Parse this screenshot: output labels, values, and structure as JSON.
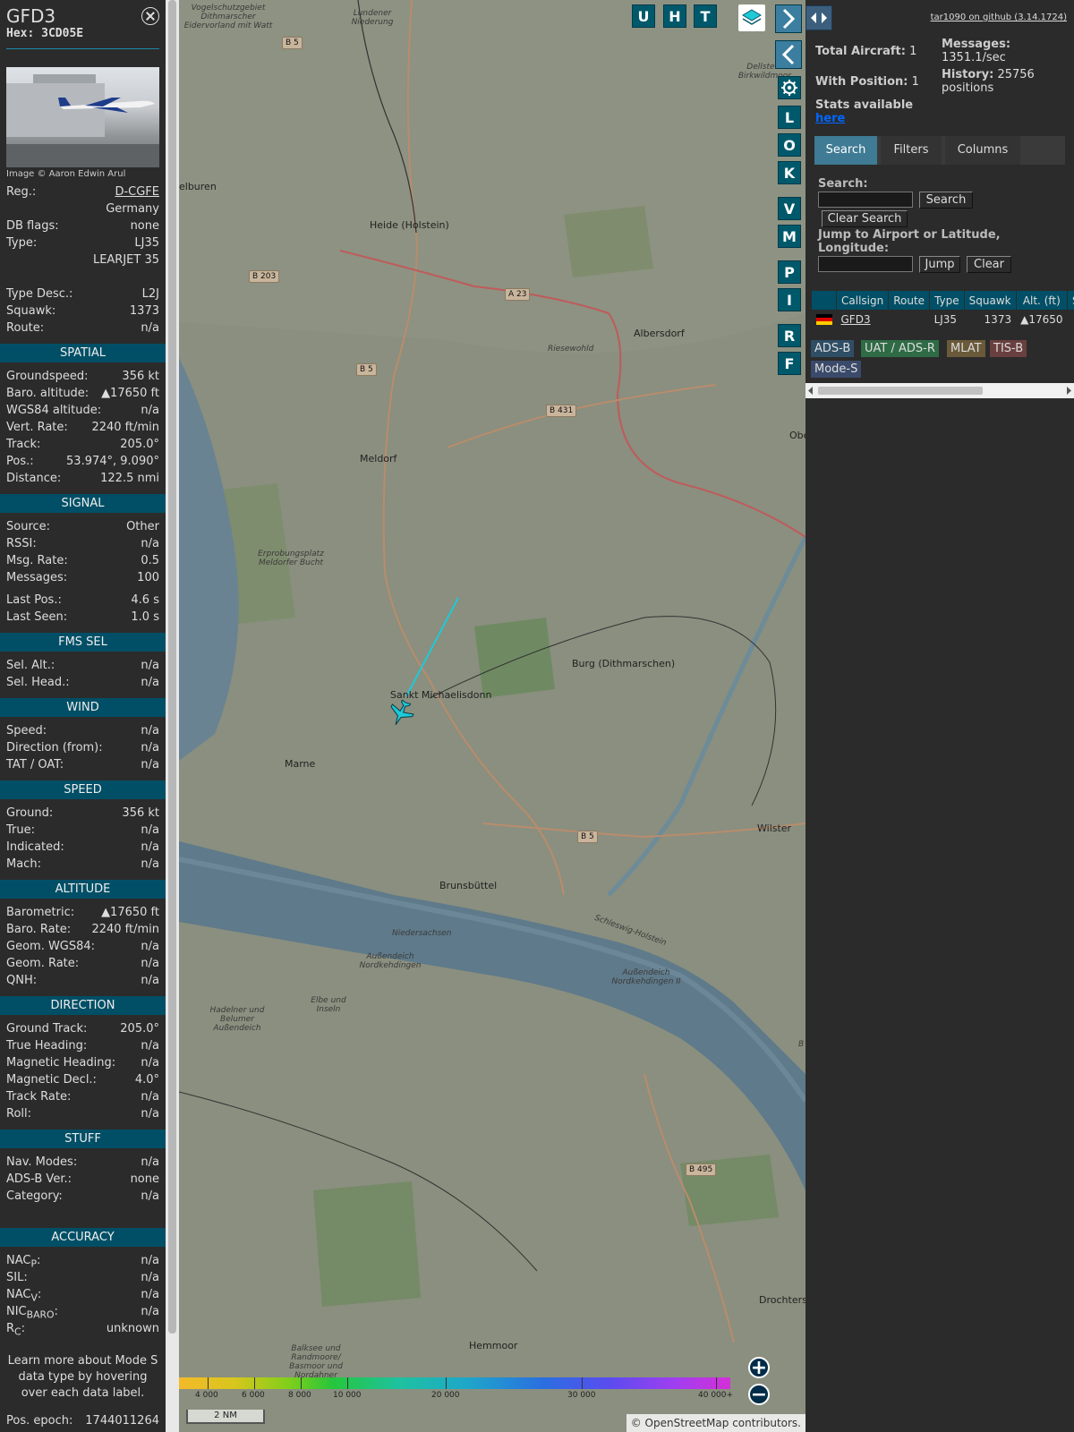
{
  "sidebar": {
    "callsign": "GFD3",
    "hex": "Hex: 3CD05E",
    "photo_credit": "Image © Aaron Edwin Arul",
    "info": [
      {
        "label": "Reg.:",
        "value": "D-CGFE",
        "link": true
      },
      {
        "label": "",
        "value": "Germany"
      },
      {
        "label": "DB flags:",
        "value": "none"
      },
      {
        "label": "Type:",
        "value": "LJ35"
      },
      {
        "label": "",
        "value": "LEARJET 35"
      },
      {
        "label": "",
        "value": ""
      },
      {
        "label": "Type Desc.:",
        "value": "L2J"
      },
      {
        "label": "Squawk:",
        "value": "1373"
      },
      {
        "label": "Route:",
        "value": "n/a"
      }
    ],
    "sections": [
      {
        "title": "SPATIAL",
        "rows": [
          {
            "label": "Groundspeed:",
            "value": "356 kt"
          },
          {
            "label": "Baro. altitude:",
            "value": "▲17650 ft"
          },
          {
            "label": "WGS84 altitude:",
            "value": "n/a"
          },
          {
            "label": "Vert. Rate:",
            "value": "2240 ft/min"
          },
          {
            "label": "Track:",
            "value": "205.0°"
          },
          {
            "label": "Pos.:",
            "value": "53.974°, 9.090°"
          },
          {
            "label": "Distance:",
            "value": "122.5 nmi"
          }
        ]
      },
      {
        "title": "SIGNAL",
        "rows": [
          {
            "label": "Source:",
            "value": "Other"
          },
          {
            "label": "RSSI:",
            "value": "n/a"
          },
          {
            "label": "Msg. Rate:",
            "value": "0.5"
          },
          {
            "label": "Messages:",
            "value": "100"
          },
          {
            "gap": true
          },
          {
            "label": "Last Pos.:",
            "value": "4.6 s"
          },
          {
            "label": "Last Seen:",
            "value": "1.0 s"
          }
        ]
      },
      {
        "title": "FMS SEL",
        "rows": [
          {
            "label": "Sel. Alt.:",
            "value": "n/a"
          },
          {
            "label": "Sel. Head.:",
            "value": "n/a"
          }
        ]
      },
      {
        "title": "WIND",
        "rows": [
          {
            "label": "Speed:",
            "value": "n/a"
          },
          {
            "label": "Direction (from):",
            "value": "n/a"
          },
          {
            "label": "TAT / OAT:",
            "value": "n/a"
          }
        ]
      },
      {
        "title": "SPEED",
        "rows": [
          {
            "label": "Ground:",
            "value": "356 kt"
          },
          {
            "label": "True:",
            "value": "n/a"
          },
          {
            "label": "Indicated:",
            "value": "n/a"
          },
          {
            "label": "Mach:",
            "value": "n/a"
          }
        ]
      },
      {
        "title": "ALTITUDE",
        "rows": [
          {
            "label": "Barometric:",
            "value": "▲17650 ft"
          },
          {
            "label": "Baro. Rate:",
            "value": "2240 ft/min"
          },
          {
            "label": "Geom. WGS84:",
            "value": "n/a"
          },
          {
            "label": "Geom. Rate:",
            "value": "n/a"
          },
          {
            "label": "QNH:",
            "value": "n/a"
          }
        ]
      },
      {
        "title": "DIRECTION",
        "rows": [
          {
            "label": "Ground Track:",
            "value": "205.0°"
          },
          {
            "label": "True Heading:",
            "value": "n/a"
          },
          {
            "label": "Magnetic Heading:",
            "value": "n/a"
          },
          {
            "label": "Magnetic Decl.:",
            "value": "4.0°"
          },
          {
            "label": "Track Rate:",
            "value": "n/a"
          },
          {
            "label": "Roll:",
            "value": "n/a"
          }
        ]
      },
      {
        "title": "STUFF",
        "rows": [
          {
            "label": "Nav. Modes:",
            "value": "n/a"
          },
          {
            "label": "ADS-B Ver.:",
            "value": "none"
          },
          {
            "label": "Category:",
            "value": "n/a"
          },
          {
            "gap": true
          },
          {
            "gap": true
          },
          {
            "gap": true
          }
        ]
      },
      {
        "title": "ACCURACY",
        "rows": [
          {
            "label": "NACP:",
            "value": "n/a",
            "html_label": "NAC<sub>P</sub>:"
          },
          {
            "label": "SIL:",
            "value": "n/a"
          },
          {
            "label": "NACV:",
            "value": "n/a",
            "html_label": "NAC<sub>V</sub>:"
          },
          {
            "label": "NICBARO:",
            "value": "n/a",
            "html_label": "NIC<sub>BARO</sub>:"
          },
          {
            "label": "RC:",
            "value": "unknown",
            "html_label": "R<sub>C</sub>:"
          }
        ]
      }
    ],
    "learn_more": "Learn more about Mode S data type by hovering over each data label.",
    "pos_epoch_label": "Pos. epoch:",
    "pos_epoch_value": "1744011264"
  },
  "map": {
    "top_buttons": [
      "U",
      "H",
      "T"
    ],
    "side_buttons": [
      "L",
      "O",
      "K",
      "V",
      "M",
      "P",
      "I",
      "R",
      "F"
    ],
    "places": [
      {
        "name": "Heide (Holstein)"
      },
      {
        "name": "Albersdorf"
      },
      {
        "name": "Meldorf"
      },
      {
        "name": "Burg (Dithmarschen)"
      },
      {
        "name": "Sankt Michaelisdonn"
      },
      {
        "name": "Marne"
      },
      {
        "name": "Wilster"
      },
      {
        "name": "Brunsbüttel"
      },
      {
        "name": "Hemmoor"
      },
      {
        "name": "Drochters"
      },
      {
        "name": "elburen"
      },
      {
        "name": "Obe"
      }
    ],
    "small_places": [
      "Riesewohld",
      "Erprobungsplatz Meldorfer Bucht",
      "Niedersachsen",
      "Schleswig-Holstein",
      "Außendeich Nordkehdingen",
      "Außendeich Nordkehdingen II",
      "Elbe und Inseln",
      "Hadelner und Belumer Außendeich",
      "Balksee und Randmoore/ Basmoor und Nordahner",
      "Dellstedter Birkwildmoor",
      "Lundener Niederung",
      "Vogelschutzgebiet Dithmarscher Eidervorland mit Watt",
      "B"
    ],
    "roads": [
      "B 5",
      "B 203",
      "A 23",
      "B 5",
      "B 431",
      "B 5",
      "B 495"
    ],
    "colorbar_labels": [
      "4 000",
      "6 000",
      "8 000",
      "10 000",
      "20 000",
      "30 000",
      "40 000+"
    ],
    "scale_label": "2 NM",
    "attribution_prefix": "© ",
    "attribution_link": "OpenStreetMap",
    "attribution_suffix": " contributors."
  },
  "panel": {
    "github_link": "tar1090 on github (3.14.1724)",
    "total_aircraft_label": "Total Aircraft:",
    "total_aircraft_value": "1",
    "with_position_label": "With Position:",
    "with_position_value": "1",
    "stats_label": "Stats available",
    "stats_link": "here",
    "messages_label": "Messages:",
    "messages_value": "1351.1/sec",
    "history_label": "History:",
    "history_value": "25756",
    "history_unit": "positions",
    "tabs": [
      "Search",
      "Filters",
      "Columns"
    ],
    "search_label": "Search:",
    "search_button": "Search",
    "clear_search_button": "Clear Search",
    "jump_label": "Jump to Airport or Latitude, Longitude:",
    "jump_button": "Jump",
    "clear_button": "Clear",
    "table_headers": [
      "",
      "Callsign",
      "Route",
      "Type",
      "Squawk",
      "Alt. (ft)",
      "Spd"
    ],
    "table_rows": [
      {
        "flag": "de",
        "callsign": "GFD3",
        "route": "",
        "type": "LJ35",
        "squawk": "1373",
        "alt": "▲17650",
        "spd": ""
      }
    ],
    "legend": [
      {
        "label": "ADS-B",
        "color": "#2e4e66"
      },
      {
        "label": "UAT / ADS-R",
        "color": "#2f6b45"
      },
      {
        "label": "MLAT",
        "color": "#6a5a3a"
      },
      {
        "label": "TIS-B",
        "color": "#6a3f3f"
      },
      {
        "label": "Mode-S",
        "color": "#3a4a6a"
      }
    ]
  }
}
